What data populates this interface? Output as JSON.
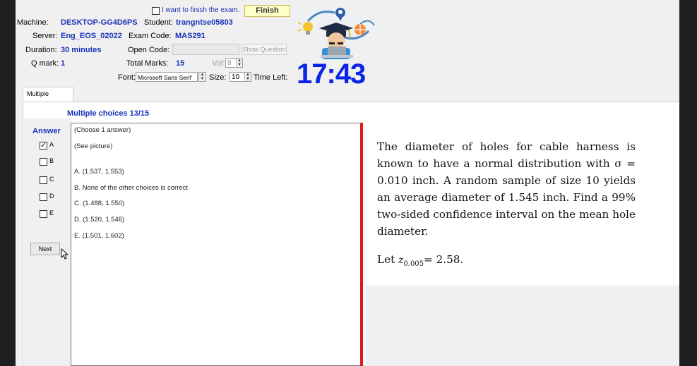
{
  "header": {
    "finish_checkbox_label": "I want to finish the exam.",
    "finish_button": "Finish",
    "machine_label": "Machine:",
    "machine_value": "DESKTOP-GG4D6PS",
    "student_label": "Student:",
    "student_value": "trangntse05803",
    "server_label": "Server:",
    "server_value": "Eng_EOS_02022",
    "exam_code_label": "Exam Code:",
    "exam_code_value": "MAS291",
    "duration_label": "Duration:",
    "duration_value": "30 minutes",
    "open_code_label": "Open Code:",
    "open_code_value": "",
    "show_question_button": "Show Question",
    "qmark_label": "Q mark:",
    "qmark_value": "1",
    "total_marks_label": "Total Marks:",
    "total_marks_value": "15",
    "vol_label": "Vol:",
    "vol_value": "8",
    "font_label": "Font:",
    "font_value": "Microsoft Sans Serif",
    "size_label": "Size:",
    "size_value": "10",
    "time_left_label": "Time Left:",
    "time_left_value": "17:43"
  },
  "tabs": [
    {
      "label": "Multiple Choices"
    }
  ],
  "section_title": "Multiple choices 13/15",
  "answer": {
    "heading": "Answer",
    "choices": [
      {
        "letter": "A",
        "checked": true
      },
      {
        "letter": "B",
        "checked": false
      },
      {
        "letter": "C",
        "checked": false
      },
      {
        "letter": "D",
        "checked": false
      },
      {
        "letter": "E",
        "checked": false
      }
    ],
    "next_button": "Next"
  },
  "options_panel": {
    "instruction": "(Choose 1 answer)",
    "see_picture": "(See picture)",
    "options": [
      "A. (1.537, 1.553)",
      "B. None of the other choices is correct",
      "C. (1.488, 1.550)",
      "D. (1.520, 1.546)",
      "E. (1.501, 1.602)"
    ]
  },
  "question": {
    "paragraph": "The diameter of holes for cable harness is known to have a normal distribution with σ = 0.010 inch. A random sample of size 10 yields an average diameter of 1.545 inch. Find a 99% two-sided confidence interval on the mean hole diameter.",
    "hint_prefix": "Let ",
    "hint_symbol": "z",
    "hint_subscript": "0.005",
    "hint_suffix": "= 2.58."
  },
  "colors": {
    "label_blue": "#1a33b8",
    "timer_blue": "#0c25e8",
    "divider_red": "#e01b17",
    "finish_yellow": "#ffffc8"
  }
}
